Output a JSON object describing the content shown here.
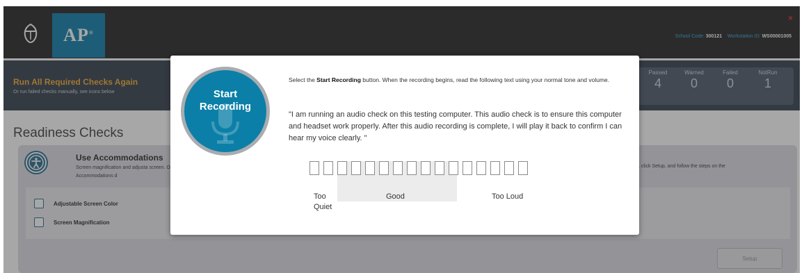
{
  "header": {
    "ap_logo": "AP",
    "ap_sup": "®",
    "school_code_label": "School Code:",
    "school_code_value": "300121",
    "workstation_label": "Workstation ID:",
    "workstation_value": "WS00001005",
    "close_glyph": "×"
  },
  "run_bar": {
    "title": "Run All Required Checks Again",
    "subtitle": "Or run failed checks manually, see icons below"
  },
  "stats": [
    {
      "label": "Passed",
      "value": "4"
    },
    {
      "label": "Warned",
      "value": "0"
    },
    {
      "label": "Failed",
      "value": "0"
    },
    {
      "label": "NotRun",
      "value": "1"
    }
  ],
  "readiness": {
    "title": "Readiness Checks"
  },
  "accommodations": {
    "title": "Use Accommodations",
    "desc_left": "Screen magnification and adjusta screen. Other Accommodations d",
    "desc_right": ", click Setup, and follow the steps on the",
    "items": [
      {
        "label": "Adjustable Screen Color"
      },
      {
        "label": "Screen Magnification"
      }
    ],
    "setup_label": "Setup"
  },
  "modal": {
    "record_line1": "Start",
    "record_line2": "Recording",
    "instr_prefix": "Select the ",
    "instr_bold": "Start Recording",
    "instr_suffix": " button. When the recording begins, read the following text using your normal tone and volume.",
    "quote": "\"I am running an audio check on this testing computer. This audio check is to ensure this computer and headset work properly. After this audio recording is complete, I will play it back to confirm I can hear my voice clearly. \"",
    "meter_level": 0,
    "meter_segments": 16,
    "label_too_quiet_1": "Too",
    "label_too_quiet_2": "Quiet",
    "label_good": "Good",
    "label_too_loud": "Too Loud"
  },
  "colors": {
    "accent_blue": "#0b7fa7",
    "header_bg": "#1e1e1e",
    "run_title_orange": "#f2a82c",
    "close_red": "#e0201e"
  },
  "icons": {
    "logo": "acorn-icon",
    "accessibility": "accessibility-icon",
    "mic": "microphone-icon",
    "close": "close-icon"
  }
}
